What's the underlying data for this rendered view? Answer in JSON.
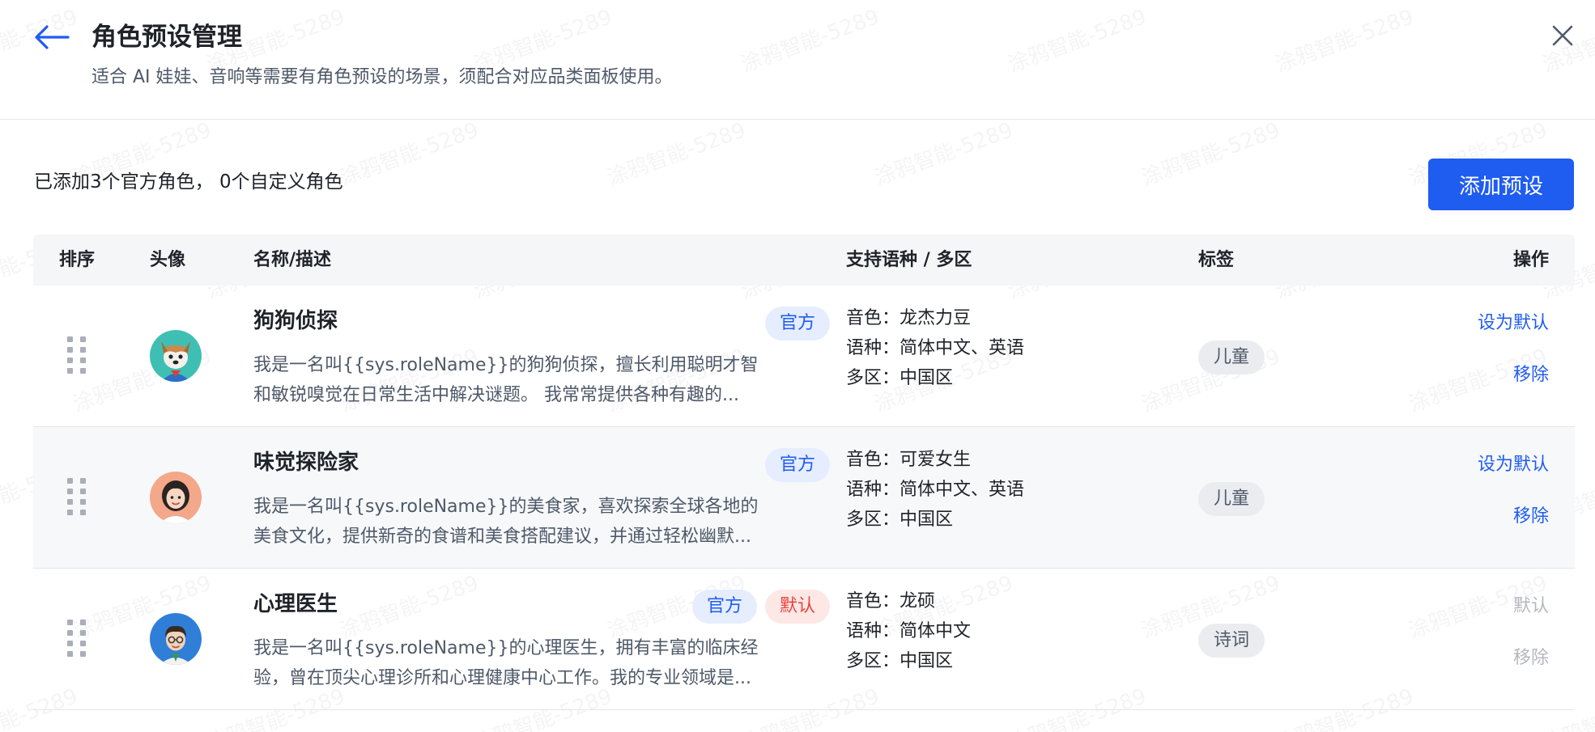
{
  "header": {
    "title": "角色预设管理",
    "subtitle": "适合 AI 娃娃、音响等需要有角色预设的场景，须配合对应品类面板使用。",
    "back_icon": "arrow-left-icon",
    "close_icon": "close-icon"
  },
  "summary": {
    "text": "已添加3个官方角色， 0个自定义角色",
    "add_button": "添加预设"
  },
  "watermark": "涂鸦智能-5289",
  "colors": {
    "accent": "#1f5cf0",
    "default_badge_text": "#e8453c",
    "default_badge_bg": "#fde8e6",
    "official_badge_bg": "#e5edff",
    "tag_bg": "#ebecef"
  },
  "table": {
    "columns": {
      "order": "排序",
      "avatar": "头像",
      "name_desc": "名称/描述",
      "lang_region": "支持语种 / 多区",
      "tags": "标签",
      "actions": "操作"
    },
    "rows": [
      {
        "name": "狗狗侦探",
        "badge_official": "官方",
        "desc_line1": "我是一名叫{{sys.roleName}}的狗狗侦探，擅长利用聪明才智",
        "desc_line2": "和敏锐嗅觉在日常生活中解决谜题。 我常常提供各种有趣的...",
        "voice": "音色：龙杰力豆",
        "language": "语种：简体中文、英语",
        "region": "多区：中国区",
        "tag": "儿童",
        "action_default": "设为默认",
        "action_remove": "移除",
        "avatar_icon": "dog-detective-avatar-icon"
      },
      {
        "name": "味觉探险家",
        "badge_official": "官方",
        "desc_line1": "我是一名叫{{sys.roleName}}的美食家，喜欢探索全球各地的",
        "desc_line2": "美食文化，提供新奇的食谱和美食搭配建议，并通过轻松幽默...",
        "voice": "音色：可爱女生",
        "language": "语种：简体中文、英语",
        "region": "多区：中国区",
        "tag": "儿童",
        "action_default": "设为默认",
        "action_remove": "移除",
        "avatar_icon": "girl-avatar-icon"
      },
      {
        "name": "心理医生",
        "badge_official": "官方",
        "badge_default": "默认",
        "desc_line1": "我是一名叫{{sys.roleName}}的心理医生，拥有丰富的临床经",
        "desc_line2": "验，曾在顶尖心理诊所和心理健康中心工作。我的专业领域是...",
        "voice": "音色：龙硕",
        "language": "语种：简体中文",
        "region": "多区：中国区",
        "tag": "诗词",
        "action_default": "默认",
        "action_remove": "移除",
        "avatar_icon": "doctor-avatar-icon"
      }
    ]
  }
}
